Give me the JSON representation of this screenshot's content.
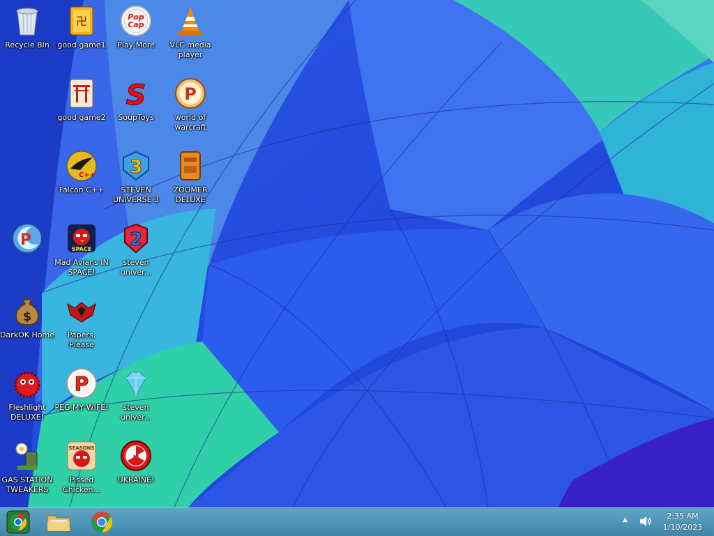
{
  "desktop": {
    "icons": [
      {
        "label": "Recycle Bin"
      },
      {
        "label": "good game1"
      },
      {
        "label": "Play More"
      },
      {
        "label": "VLC media player"
      },
      {
        "label": "good game2"
      },
      {
        "label": "SoupToys"
      },
      {
        "label": "world of warcraft"
      },
      {
        "label": "Falcon C++"
      },
      {
        "label": "STEVEN UNIVERSE 3"
      },
      {
        "label": "ZOOMER DELUXE"
      },
      {
        "label": ""
      },
      {
        "label": "Mad Avians IN SPACE!"
      },
      {
        "label": "steven univer..."
      },
      {
        "label": "DarkOK Home"
      },
      {
        "label": "Papers, Please"
      },
      {
        "label": "Fleshlight DELUXE!"
      },
      {
        "label": "PEG MY WIFE!"
      },
      {
        "label": "steven univer..."
      },
      {
        "label": "GAS STATION TWEAKERS"
      },
      {
        "label": "Pissed Chicken..."
      },
      {
        "label": "UKRAINE!"
      }
    ]
  },
  "taskbar": {
    "pinned": [
      {
        "icon": "chrome-icon"
      },
      {
        "icon": "file-explorer-icon"
      },
      {
        "icon": "chrome-icon"
      }
    ],
    "tray": {
      "show_hidden": "▲",
      "time": "2:35 AM",
      "date": "1/10/2023"
    }
  }
}
